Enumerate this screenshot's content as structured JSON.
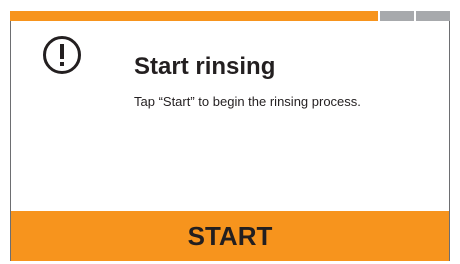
{
  "progress": {
    "total_steps": 3,
    "active_steps": 1
  },
  "dialog": {
    "icon": "exclamation-circle-icon",
    "title": "Start rinsing",
    "message": "Tap “Start” to begin the rinsing process."
  },
  "actions": {
    "start_label": "START"
  },
  "colors": {
    "accent": "#f7941d",
    "pending": "#a7a9ac",
    "text": "#231f20",
    "border": "#6d6e71"
  }
}
